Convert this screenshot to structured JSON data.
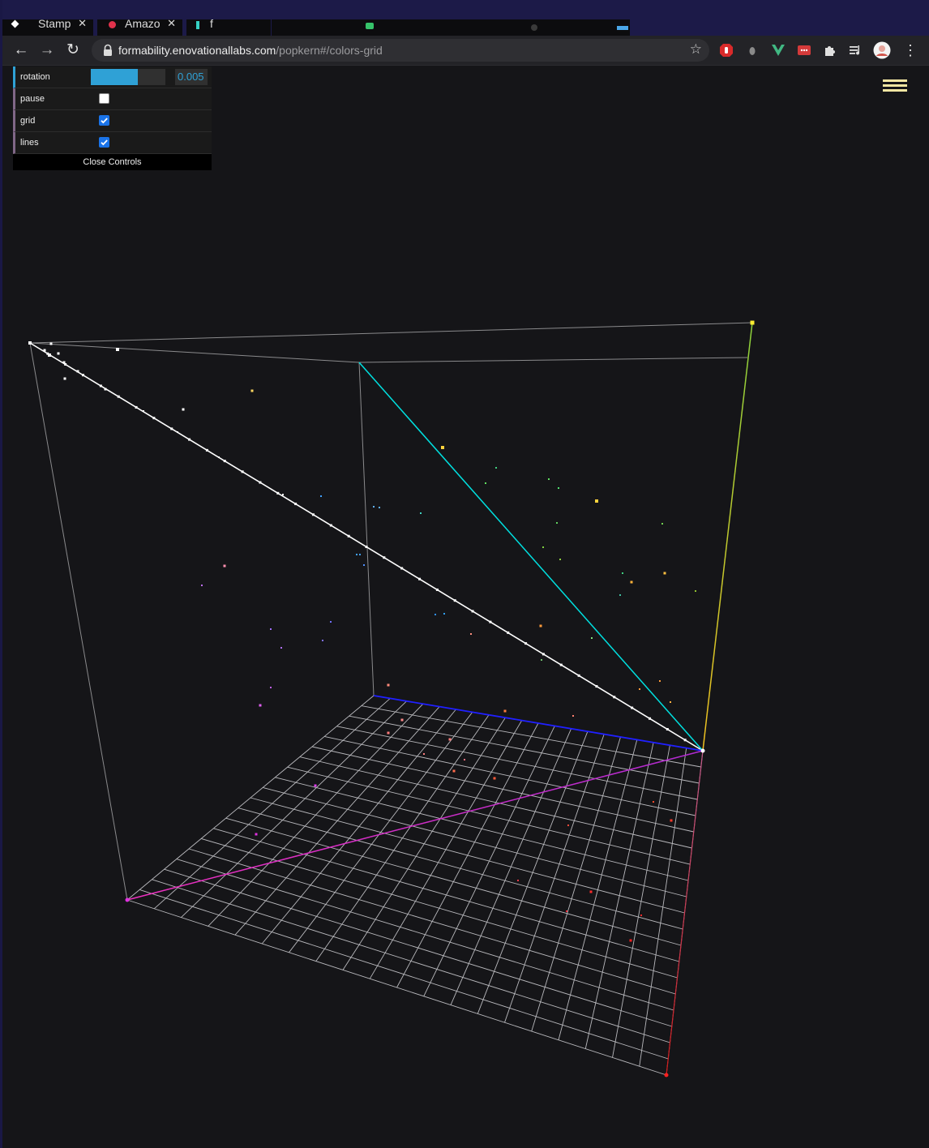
{
  "browser": {
    "tabs": [
      {
        "title": "Stamp",
        "close": "✕",
        "favicon_color": "#ffffff"
      },
      {
        "title": "Amazo",
        "close": "✕",
        "favicon_color": "#e0324b"
      },
      {
        "title": "f",
        "close": "",
        "favicon_color": "#35d0c3"
      }
    ],
    "url_host": "formability.enovationallabs.com",
    "url_path": "/popkern#/colors-grid",
    "icons": [
      "back-arrow-icon",
      "forward-arrow-icon",
      "reload-icon",
      "lock-icon",
      "bookmark-star-icon",
      "extension-icons",
      "puzzle-icon",
      "media-queue-icon",
      "profile-avatar-icon",
      "more-menu-icon"
    ]
  },
  "controls": {
    "rotation": {
      "label": "rotation",
      "value": "0.005",
      "fill_fraction": 0.63
    },
    "pause": {
      "label": "pause",
      "checked": false
    },
    "grid": {
      "label": "grid",
      "checked": true
    },
    "lines": {
      "label": "lines",
      "checked": true
    },
    "close_label": "Close Controls"
  },
  "colors": {
    "background": "#151518",
    "accent": "#2fa1d6",
    "white_axis": "#ffffff",
    "cyan_axis": "#00e0e0",
    "blue_axis": "#2020ff",
    "magenta_axis": "#e030e0",
    "yellow_green_axis": "#9acd32",
    "red_axis": "#e02020",
    "menu_icon": "#f2e6a2"
  },
  "visualization": {
    "name": "colors-grid",
    "grid": true,
    "lines": true,
    "grid_divisions": 20
  }
}
